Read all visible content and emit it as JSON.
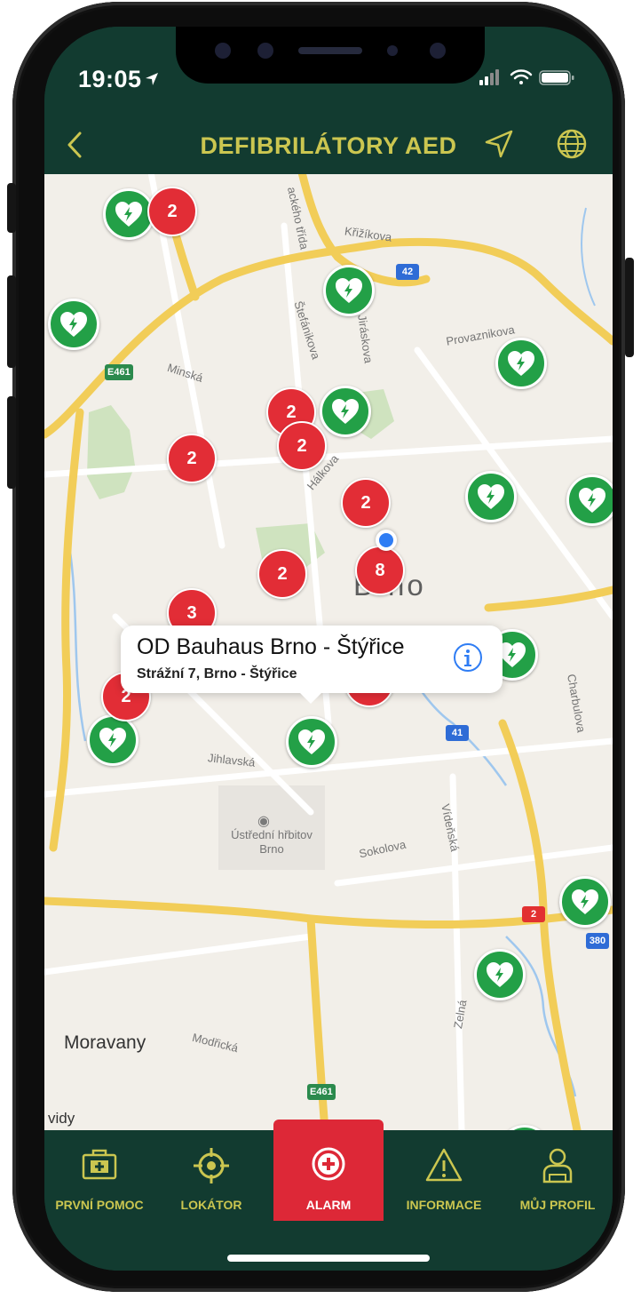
{
  "status_bar": {
    "time": "19:05"
  },
  "nav": {
    "title": "DEFIBRILÁTORY AED"
  },
  "map": {
    "city": "Brno",
    "streets": [
      "Křižíkova",
      "Štefánikova",
      "Provaznikova",
      "Minská",
      "Jihlavská",
      "Sokolova",
      "Charbulova",
      "Zelná",
      "Modřická",
      "ackého třída",
      "Jiráskova",
      "Hálkova",
      "Vídeňská"
    ],
    "places": [
      "Ústřední hřbitov Brno",
      "Moravany"
    ],
    "road_shields": [
      "42",
      "E461",
      "41",
      "2",
      "380",
      "E461"
    ],
    "clusters": [
      "2",
      "2",
      "2",
      "2",
      "2",
      "2",
      "8",
      "3",
      "2",
      "2"
    ],
    "legal_text": "vidy"
  },
  "callout": {
    "title": "OD Bauhaus Brno - Štýřice",
    "subtitle": "Strážní 7, Brno - Štýřice"
  },
  "tabs": [
    {
      "label": "PRVNÍ POMOC",
      "icon": "first-aid-kit-icon"
    },
    {
      "label": "LOKÁTOR",
      "icon": "target-locator-icon"
    },
    {
      "label": "ALARM",
      "icon": "alarm-plus-icon"
    },
    {
      "label": "INFORMACE",
      "icon": "warning-triangle-icon"
    },
    {
      "label": "MŮJ PROFIL",
      "icon": "profile-icon"
    }
  ],
  "colors": {
    "header_bg": "#123b30",
    "accent_text": "#cbc650",
    "aed_green": "#23a047",
    "cluster_red": "#e22d36",
    "alarm_red": "#dd2837"
  }
}
